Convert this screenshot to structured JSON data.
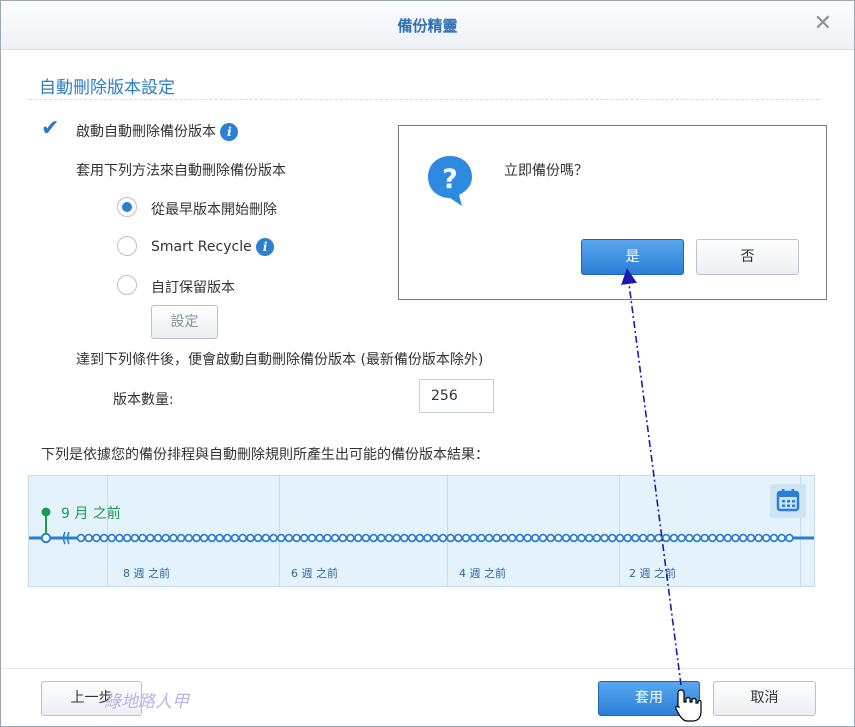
{
  "window": {
    "title": "備份精靈"
  },
  "section": {
    "title": "自動刪除版本設定"
  },
  "enable": {
    "label": "啟動自動刪除備份版本",
    "checked": true
  },
  "method": {
    "heading": "套用下列方法來自動刪除備份版本",
    "options": [
      {
        "label": "從最早版本開始刪除",
        "selected": true
      },
      {
        "label": "Smart Recycle",
        "selected": false
      },
      {
        "label": "自訂保留版本",
        "selected": false
      }
    ],
    "settings_button": "設定"
  },
  "condition": {
    "text": "達到下列條件後，便會啟動自動刪除備份版本 (最新備份版本除外)",
    "version_count_label": "版本數量:",
    "version_count_value": "256"
  },
  "timeline": {
    "caption": "下列是依據您的備份排程與自動刪除規則所產生出可能的備份版本結果：",
    "marker_label": "9 月 之前",
    "week_labels": [
      "8 週 之前",
      "6 週 之前",
      "4 週 之前",
      "2 週 之前"
    ],
    "calendar_icon": "calendar-icon",
    "color_line": "#2a7fd4",
    "color_marker": "#1e9a4e"
  },
  "dialog": {
    "message": "立即備份嗎？",
    "yes_label": "是",
    "no_label": "否",
    "icon": "question-bubble-icon"
  },
  "footer": {
    "prev_label": "上一步",
    "apply_label": "套用",
    "cancel_label": "取消",
    "watermark": "綠地路人甲"
  }
}
